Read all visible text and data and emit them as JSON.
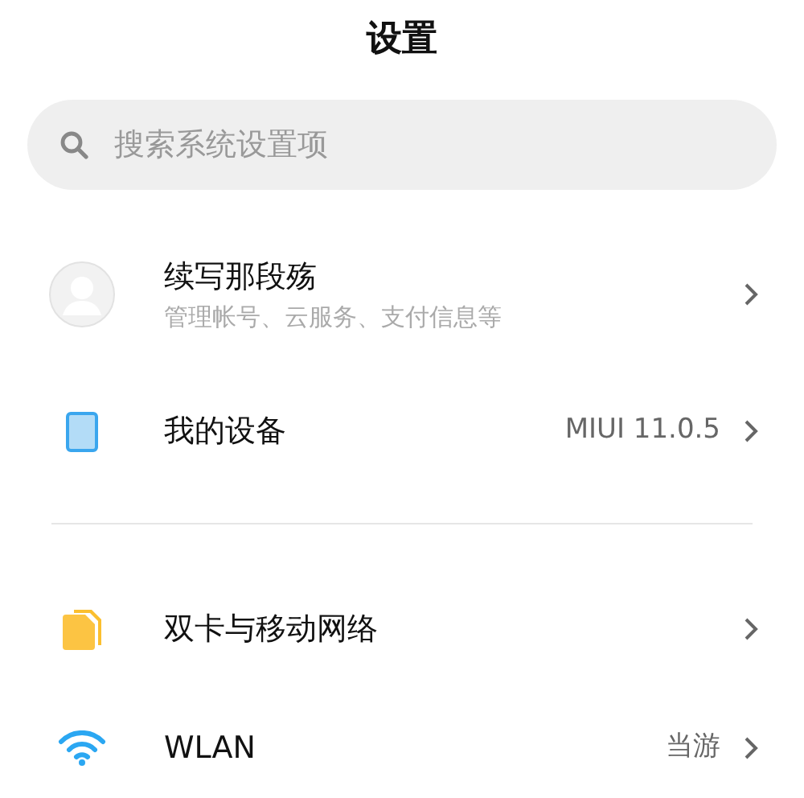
{
  "title": "设置",
  "search": {
    "placeholder": "搜索系统设置项"
  },
  "sections": [
    {
      "items": [
        {
          "kind": "account",
          "label": "续写那段殇",
          "subtitle": "管理帐号、云服务、支付信息等"
        },
        {
          "kind": "device",
          "label": "我的设备",
          "value": "MIUI 11.0.5"
        }
      ]
    },
    {
      "items": [
        {
          "kind": "sim",
          "label": "双卡与移动网络"
        },
        {
          "kind": "wifi",
          "label": "WLAN",
          "value": "当游"
        }
      ]
    }
  ]
}
